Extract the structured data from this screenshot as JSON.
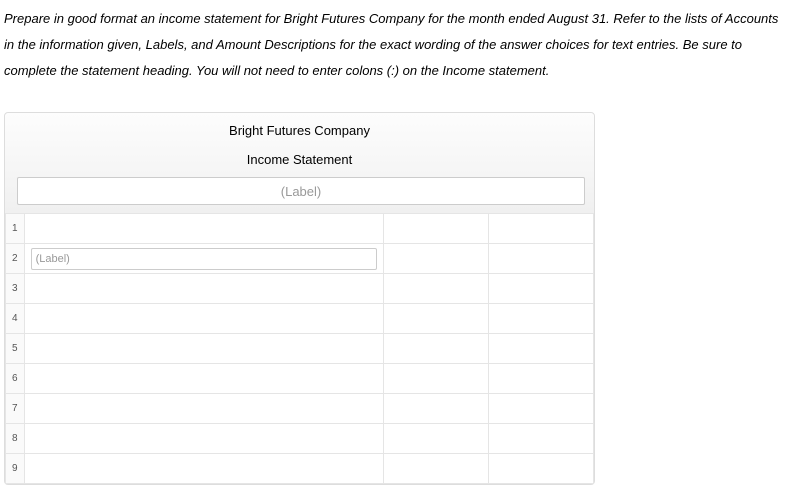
{
  "instructions": "Prepare in good format an income statement for Bright Futures Company for the month ended August 31. Refer to the lists of Accounts in the information given, Labels, and Amount Descriptions for the exact wording of the answer choices for text entries. Be sure to complete the statement heading. You will not need to enter colons (:) on the Income statement.",
  "statement": {
    "company_name": "Bright Futures Company",
    "title": "Income Statement",
    "heading_label_placeholder": "(Label)",
    "rows": [
      {
        "num": "1",
        "desc_placeholder": "",
        "desc_value": "",
        "amt1": "",
        "amt2": ""
      },
      {
        "num": "2",
        "desc_placeholder": "(Label)",
        "desc_value": "",
        "amt1": "",
        "amt2": ""
      },
      {
        "num": "3",
        "desc_placeholder": "",
        "desc_value": "",
        "amt1": "",
        "amt2": ""
      },
      {
        "num": "4",
        "desc_placeholder": "",
        "desc_value": "",
        "amt1": "",
        "amt2": ""
      },
      {
        "num": "5",
        "desc_placeholder": "",
        "desc_value": "",
        "amt1": "",
        "amt2": ""
      },
      {
        "num": "6",
        "desc_placeholder": "",
        "desc_value": "",
        "amt1": "",
        "amt2": ""
      },
      {
        "num": "7",
        "desc_placeholder": "",
        "desc_value": "",
        "amt1": "",
        "amt2": ""
      },
      {
        "num": "8",
        "desc_placeholder": "",
        "desc_value": "",
        "amt1": "",
        "amt2": ""
      },
      {
        "num": "9",
        "desc_placeholder": "",
        "desc_value": "",
        "amt1": "",
        "amt2": ""
      }
    ]
  }
}
